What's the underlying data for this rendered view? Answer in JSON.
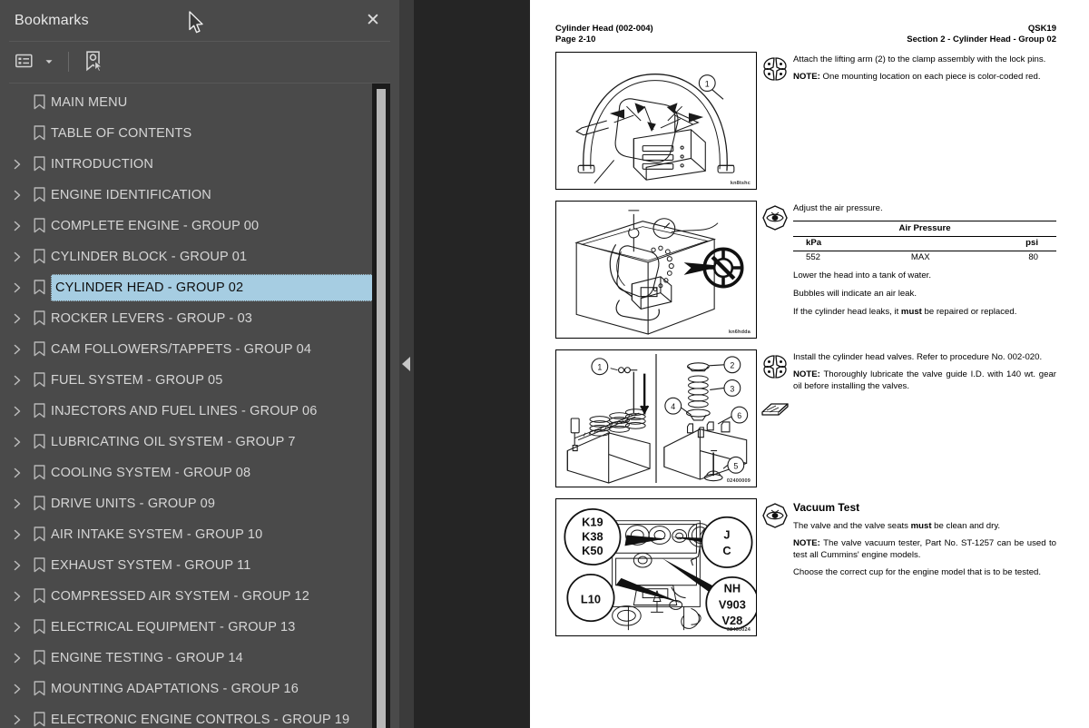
{
  "sidebar": {
    "title": "Bookmarks",
    "close_label": "✕",
    "toolbar": {
      "options_label": "list-options",
      "new_bookmark_label": "new-bookmark"
    },
    "items": [
      {
        "label": "MAIN MENU",
        "expandable": false,
        "selected": false
      },
      {
        "label": "TABLE OF CONTENTS",
        "expandable": false,
        "selected": false
      },
      {
        "label": "INTRODUCTION",
        "expandable": true,
        "selected": false
      },
      {
        "label": "ENGINE IDENTIFICATION",
        "expandable": true,
        "selected": false
      },
      {
        "label": "COMPLETE ENGINE - GROUP 00",
        "expandable": true,
        "selected": false
      },
      {
        "label": "CYLINDER BLOCK - GROUP 01",
        "expandable": true,
        "selected": false
      },
      {
        "label": "CYLINDER HEAD - GROUP 02",
        "expandable": true,
        "selected": true
      },
      {
        "label": "ROCKER LEVERS - GROUP - 03",
        "expandable": true,
        "selected": false
      },
      {
        "label": "CAM FOLLOWERS/TAPPETS - GROUP 04",
        "expandable": true,
        "selected": false
      },
      {
        "label": "FUEL SYSTEM - GROUP 05",
        "expandable": true,
        "selected": false
      },
      {
        "label": "INJECTORS AND FUEL LINES - GROUP 06",
        "expandable": true,
        "selected": false
      },
      {
        "label": "LUBRICATING OIL SYSTEM - GROUP 7",
        "expandable": true,
        "selected": false
      },
      {
        "label": "COOLING SYSTEM - GROUP 08",
        "expandable": true,
        "selected": false
      },
      {
        "label": "DRIVE UNITS - GROUP 09",
        "expandable": true,
        "selected": false
      },
      {
        "label": "AIR INTAKE SYSTEM - GROUP 10",
        "expandable": true,
        "selected": false
      },
      {
        "label": "EXHAUST SYSTEM - GROUP 11",
        "expandable": true,
        "selected": false
      },
      {
        "label": "COMPRESSED AIR SYSTEM - GROUP 12",
        "expandable": true,
        "selected": false
      },
      {
        "label": "ELECTRICAL EQUIPMENT - GROUP 13",
        "expandable": true,
        "selected": false
      },
      {
        "label": "ENGINE TESTING - GROUP 14",
        "expandable": true,
        "selected": false
      },
      {
        "label": "MOUNTING ADAPTATIONS - GROUP 16",
        "expandable": true,
        "selected": false
      },
      {
        "label": "ELECTRONIC ENGINE CONTROLS - GROUP 19",
        "expandable": true,
        "selected": false
      }
    ]
  },
  "splitter": {
    "collapse_label": "◀"
  },
  "document": {
    "header": {
      "title_left": "Cylinder Head (002-004)",
      "page_left": "Page 2-10",
      "title_right": "QSK19",
      "section_right": "Section 2 - Cylinder Head - Group 02"
    },
    "blocks": [
      {
        "figure_caption": "kn8tshc",
        "figure_callouts": [
          "1"
        ],
        "symbol": "wheel-segments-icon",
        "body": "Attach the lifting arm (2) to the clamp assembly with the lock pins.",
        "note_label": "NOTE:",
        "note": "One mounting location on each piece is color-coded red."
      },
      {
        "figure_caption": "kn6hdda",
        "symbol": "eye-inspect-icon",
        "body": "Adjust the air pressure.",
        "table": {
          "title": "Air Pressure",
          "headers": [
            "kPa",
            "",
            "psi"
          ],
          "rows": [
            [
              "552",
              "MAX",
              "80"
            ]
          ]
        },
        "line1": "Lower the head into a tank of water.",
        "line2": "Bubbles will indicate an air leak.",
        "line3_a": "If the cylinder head leaks, it ",
        "line3_b": "must",
        "line3_c": " be repaired or replaced."
      },
      {
        "figure_caption": "02400009",
        "figure_callouts": [
          "1",
          "2",
          "3",
          "4",
          "5",
          "6"
        ],
        "symbol": "wheel-segments-icon",
        "symbol2": "manual-pages-icon",
        "body": "Install the cylinder head valves. Refer to procedure No. 002-020.",
        "note_label": "NOTE:",
        "note": "Thoroughly lubricate the valve guide I.D. with 140 wt. gear oil before installing the valves."
      },
      {
        "figure_caption": "02400024",
        "figure_callouts": [
          "K19",
          "K38",
          "K50",
          "L10",
          "J",
          "C",
          "NH",
          "V903",
          "V28"
        ],
        "symbol": "eye-inspect-icon",
        "heading": "Vacuum Test",
        "body_a": "The valve and the valve seats ",
        "body_b": "must",
        "body_c": " be clean and dry.",
        "note_label": "NOTE:",
        "note": "The valve vacuum tester, Part No. ST-1257 can be used to test all Cummins' engine models.",
        "line2": "Choose the correct cup for the engine model that is to be tested."
      }
    ]
  },
  "colors": {
    "sidebar_bg": "#4a4a4a",
    "selection": "#a6cde2",
    "gutter": "#252525",
    "page": "#ffffff"
  }
}
